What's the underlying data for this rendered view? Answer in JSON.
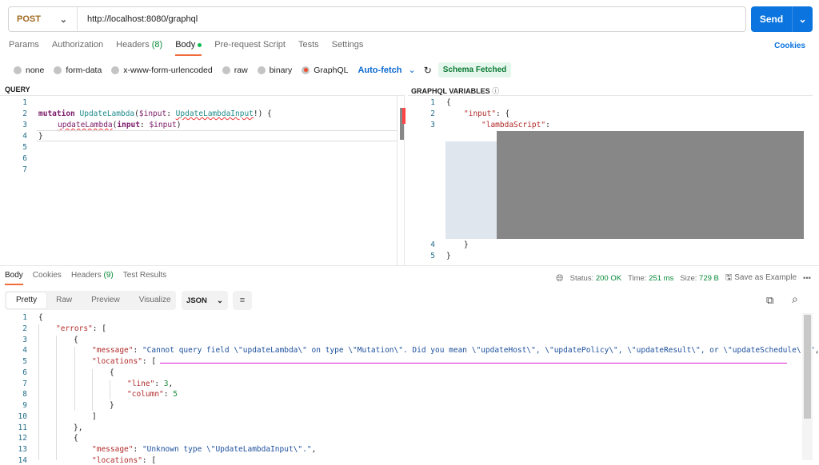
{
  "request": {
    "method": "POST",
    "url": "http://localhost:8080/graphql",
    "send_label": "Send"
  },
  "tabs": [
    {
      "label": "Params"
    },
    {
      "label": "Authorization"
    },
    {
      "label": "Headers",
      "count": "(8)"
    },
    {
      "label": "Body"
    },
    {
      "label": "Pre-request Script"
    },
    {
      "label": "Tests"
    },
    {
      "label": "Settings"
    }
  ],
  "cookies_label": "Cookies",
  "body_types": [
    "none",
    "form-data",
    "x-www-form-urlencoded",
    "raw",
    "binary",
    "GraphQL"
  ],
  "auto_fetch": "Auto-fetch",
  "schema_status": "Schema Fetched",
  "query": {
    "title": "QUERY",
    "lines": [
      "1",
      "2",
      "3",
      "4",
      "5",
      "6",
      "7"
    ],
    "l2": {
      "kw": "mutation",
      "name": "UpdateLambda",
      "p1": "(",
      "var": "$input",
      "c": ": ",
      "type": "UpdateLambdaInput",
      "end": "!) {"
    },
    "l3": {
      "fn": "updateLambda",
      "p1": "(",
      "arg": "input",
      "c": ": ",
      "var": "$input",
      "end": ")"
    },
    "l4": "}"
  },
  "variables": {
    "title": "GRAPHQL VARIABLES",
    "lines": [
      "1",
      "2",
      "3",
      "4",
      "5"
    ],
    "l1": "{",
    "l2key": "\"input\"",
    "l2end": ": {",
    "l3key": "\"lambdaScript\"",
    "l3end": ":",
    "l4": "}",
    "l5": "}"
  },
  "response": {
    "tabs": [
      {
        "label": "Body"
      },
      {
        "label": "Cookies"
      },
      {
        "label": "Headers",
        "count": "(9)"
      },
      {
        "label": "Test Results"
      }
    ],
    "status_label": "Status:",
    "status": "200 OK",
    "time_label": "Time:",
    "time": "251 ms",
    "size_label": "Size:",
    "size": "729 B",
    "save_label": "Save as Example",
    "views": [
      "Pretty",
      "Raw",
      "Preview",
      "Visualize"
    ],
    "format": "JSON",
    "lines": [
      "1",
      "2",
      "3",
      "4",
      "5",
      "6",
      "7",
      "8",
      "9",
      "10",
      "11",
      "12",
      "13",
      "14"
    ],
    "code": {
      "l1": "{",
      "l2k": "\"errors\"",
      "l2e": ": [",
      "l3": "{",
      "l4k": "\"message\"",
      "l4v": "\"Cannot query field \\\"updateLambda\\\" on type \\\"Mutation\\\". Did you mean \\\"updateHost\\\", \\\"updatePolicy\\\", \\\"updateResult\\\", or \\\"updateSchedule\\\"?\"",
      "l4e": ",",
      "l5k": "\"locations\"",
      "l5e": ": [",
      "l6": "{",
      "l7k": "\"line\"",
      "l7v": "3",
      "l8k": "\"column\"",
      "l8v": "5",
      "l9": "}",
      "l10": "]",
      "l11": "},",
      "l12": "{",
      "l13k": "\"message\"",
      "l13v": "\"Unknown type \\\"UpdateLambdaInput\\\".\"",
      "l13e": ",",
      "l14k": "\"locations\"",
      "l14e": ": ["
    }
  }
}
